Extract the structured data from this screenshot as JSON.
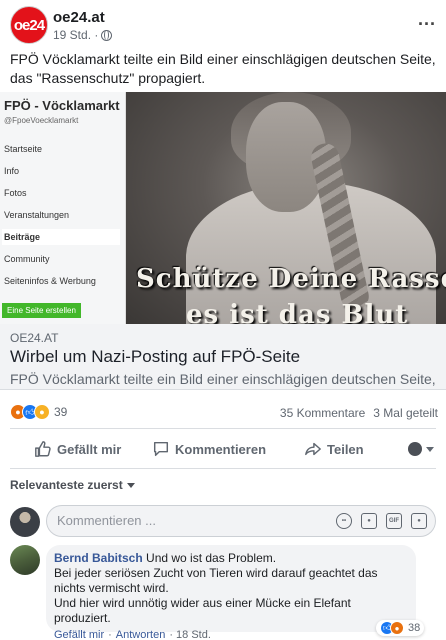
{
  "colors": {
    "brand": "#e3121a",
    "link": "#385898",
    "like": "#1877f2",
    "angry": "#e9710f",
    "haha": "#f7b125"
  },
  "header": {
    "logo_text": "oe24",
    "page_name": "oe24.at",
    "time": "19 Std. ·",
    "privacy_icon": "globe-icon",
    "more": "..."
  },
  "post": {
    "text": "FPÖ Vöcklamarkt teilte ein Bild einer einschlägigen deutschen Seite, das \"Rassenschutz\" propagiert."
  },
  "preview": {
    "sidebar": {
      "title": "FPÖ - Vöcklamarkt",
      "handle": "@FpoeVoecklamarkt",
      "items": [
        "Startseite",
        "Info",
        "Fotos",
        "Veranstaltungen",
        "Beiträge",
        "Community",
        "Seiteninfos & Werbung"
      ],
      "active_item": "Beiträge",
      "create_button": "Eine Seite erstellen"
    },
    "image_caption_1": "Schütze Deine Rasse,",
    "image_caption_2": "es ist das Blut"
  },
  "link": {
    "domain": "OE24.AT",
    "title": "Wirbel um Nazi-Posting auf FPÖ-Seite",
    "description": "FPÖ Vöcklamarkt teilte ein Bild einer einschlägigen deutschen Seite, das"
  },
  "stats": {
    "reaction_count": "39",
    "comments": "35 Kommentare",
    "shares": "3 Mal geteilt"
  },
  "actions": {
    "like": "Gefällt mir",
    "comment": "Kommentieren",
    "share": "Teilen"
  },
  "sort": {
    "label": "Relevanteste zuerst"
  },
  "comment_input": {
    "placeholder": "Kommentieren ..."
  },
  "comment": {
    "author": "Bernd Babitsch",
    "text_line1": " Und wo ist das Problem.",
    "text_line2": "Bei jeder seriösen Zucht von Tieren wird darauf geachtet das nichts vermischt wird.",
    "text_line3": "Und hier wird unnötig wider aus einer Mücke ein Elefant produziert.",
    "reaction_count": "38",
    "like": "Gefällt mir",
    "separator": "·",
    "reply": "Antworten",
    "time": "· 18 Std."
  }
}
